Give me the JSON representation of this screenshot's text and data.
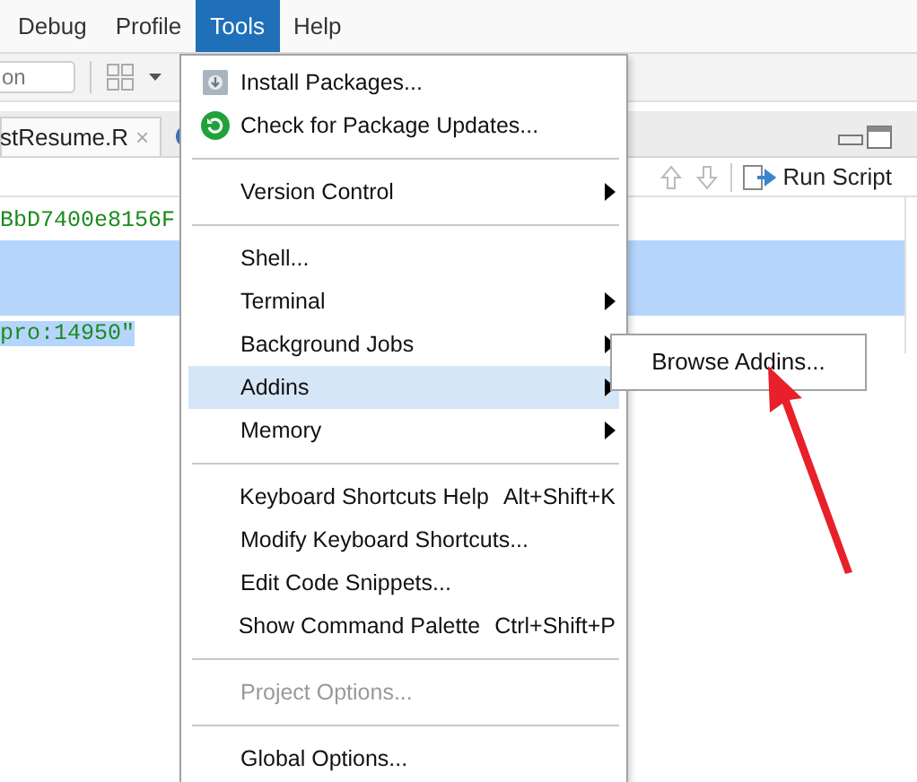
{
  "menu_bar": [
    {
      "label": "Debug",
      "selected": false
    },
    {
      "label": "Profile",
      "selected": false
    },
    {
      "label": "Tools",
      "selected": true
    },
    {
      "label": "Help",
      "selected": false
    }
  ],
  "toolbar": {
    "search_field": "on"
  },
  "editor_tabs": [
    {
      "label": "stResume.R",
      "close": "×"
    }
  ],
  "editor_toolbar": {
    "run_button": "Run Script"
  },
  "code_lines": [
    {
      "text": "BbD7400e8156F",
      "selected": false
    },
    {
      "selected": true
    },
    {
      "selected": true
    },
    {
      "text": "pro:14950\"",
      "selected": true
    }
  ],
  "tools_menu": [
    {
      "kind": "item",
      "label": "Install Packages...",
      "submenu": false,
      "disabled": false,
      "selected": false
    },
    {
      "kind": "item",
      "label": "Check for Package Updates...",
      "submenu": false,
      "disabled": false,
      "selected": false
    },
    {
      "kind": "separator"
    },
    {
      "kind": "item",
      "label": "Version Control",
      "submenu": true,
      "disabled": false,
      "selected": false
    },
    {
      "kind": "separator"
    },
    {
      "kind": "item",
      "label": "Shell...",
      "submenu": false,
      "disabled": false,
      "selected": false
    },
    {
      "kind": "item",
      "label": "Terminal",
      "submenu": true,
      "disabled": false,
      "selected": false
    },
    {
      "kind": "item",
      "label": "Background Jobs",
      "submenu": true,
      "disabled": false,
      "selected": false
    },
    {
      "kind": "item",
      "label": "Addins",
      "submenu": true,
      "disabled": false,
      "selected": true
    },
    {
      "kind": "item",
      "label": "Memory",
      "submenu": true,
      "disabled": false,
      "selected": false
    },
    {
      "kind": "separator"
    },
    {
      "kind": "item",
      "label": "Keyboard Shortcuts Help",
      "shortcut": "Alt+Shift+K",
      "submenu": false,
      "disabled": false,
      "selected": false
    },
    {
      "kind": "item",
      "label": "Modify Keyboard Shortcuts...",
      "submenu": false,
      "disabled": false,
      "selected": false
    },
    {
      "kind": "item",
      "label": "Edit Code Snippets...",
      "submenu": false,
      "disabled": false,
      "selected": false
    },
    {
      "kind": "item",
      "label": "Show Command Palette",
      "shortcut": "Ctrl+Shift+P",
      "submenu": false,
      "disabled": false,
      "selected": false
    },
    {
      "kind": "separator"
    },
    {
      "kind": "item",
      "label": "Project Options...",
      "submenu": false,
      "disabled": true,
      "selected": false
    },
    {
      "kind": "separator"
    },
    {
      "kind": "item",
      "label": "Global Options...",
      "submenu": false,
      "disabled": false,
      "selected": false
    }
  ],
  "addins_submenu": [
    {
      "label": "Browse Addins..."
    }
  ]
}
